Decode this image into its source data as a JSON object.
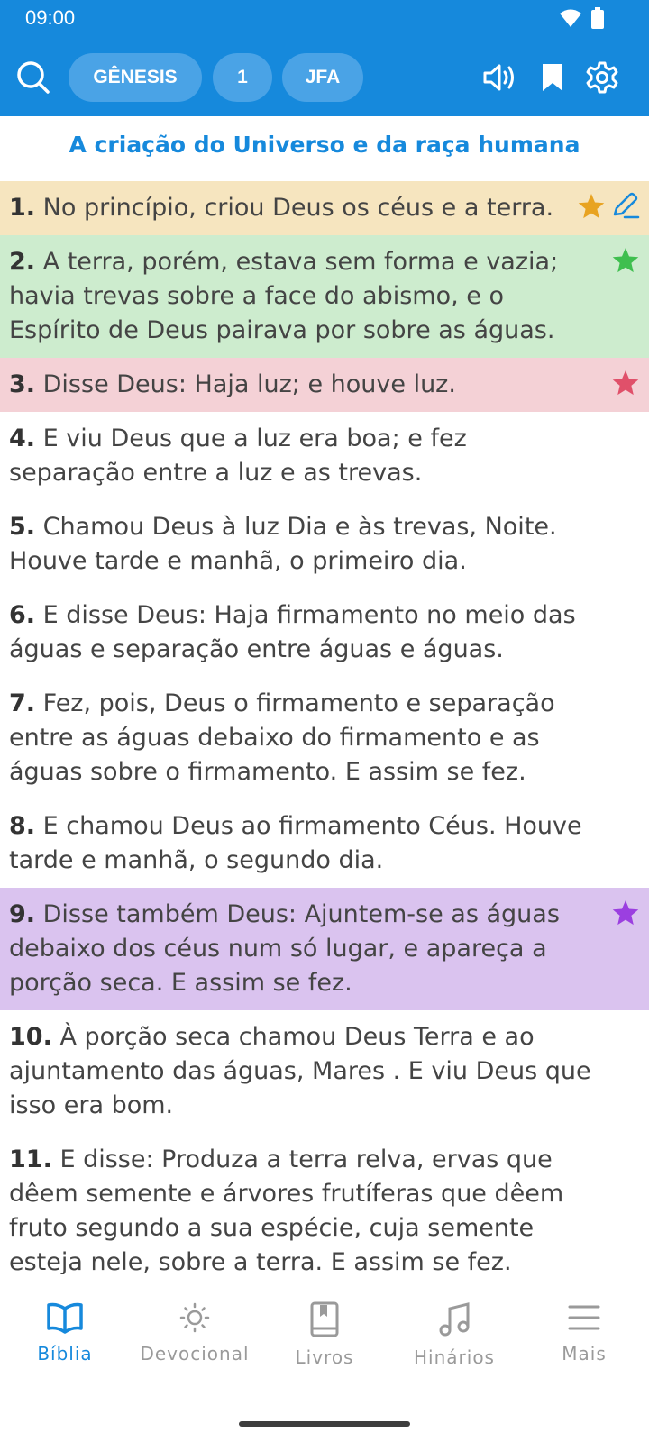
{
  "status": {
    "time": "09:00"
  },
  "toolbar": {
    "book": "GÊNESIS",
    "chapter": "1",
    "version": "JFA"
  },
  "chapter_title": "A criação do Universo e da raça humana",
  "verses": [
    {
      "num": "1.",
      "text": "No princípio, criou Deus os céus e a terra."
    },
    {
      "num": "2.",
      "text": "A terra, porém, estava sem forma e vazia; havia trevas sobre a face do abismo, e o Espírito de Deus pairava por sobre as águas."
    },
    {
      "num": "3.",
      "text": "Disse Deus: Haja luz; e houve luz."
    },
    {
      "num": "4.",
      "text": "E viu Deus que a luz era boa; e fez separação entre a luz e as trevas."
    },
    {
      "num": "5.",
      "text": "Chamou Deus à luz Dia e às trevas, Noite. Houve tarde e manhã, o primeiro dia."
    },
    {
      "num": "6.",
      "text": "E disse Deus: Haja firmamento no meio das águas e separação entre águas e águas."
    },
    {
      "num": "7.",
      "text": "Fez, pois, Deus o firmamento e separação entre as águas debaixo do firmamento e as águas sobre o firmamento. E assim se fez."
    },
    {
      "num": "8.",
      "text": "E chamou Deus ao firmamento Céus. Houve tarde e manhã, o segundo dia."
    },
    {
      "num": "9.",
      "text": "Disse também Deus: Ajuntem-se as águas debaixo dos céus num só lugar, e apareça a porção seca. E assim se fez."
    },
    {
      "num": "10.",
      "text": "À porção seca chamou Deus Terra e ao ajuntamento das águas, Mares . E viu Deus que isso era bom."
    },
    {
      "num": "11.",
      "text": "E disse: Produza a terra relva, ervas que dêem semente e árvores frutíferas que dêem fruto segundo a sua espécie, cuja semente esteja nele, sobre a terra. E assim se fez."
    }
  ],
  "highlights": {
    "yellow": "#f6e5bf",
    "green": "#cdecce",
    "red": "#f4d1d6",
    "purple": "#dac3ef"
  },
  "star_colors": {
    "yellow": "#e8a321",
    "green": "#3fbf4f",
    "red": "#e0506a",
    "purple": "#9b3fe0"
  },
  "nav": [
    {
      "label": "Bíblia",
      "icon": "open-book-icon",
      "active": true
    },
    {
      "label": "Devocional",
      "icon": "sun-icon",
      "active": false
    },
    {
      "label": "Livros",
      "icon": "book-icon",
      "active": false
    },
    {
      "label": "Hinários",
      "icon": "music-note-icon",
      "active": false
    },
    {
      "label": "Mais",
      "icon": "menu-icon",
      "active": false
    }
  ],
  "colors": {
    "primary": "#1689dc",
    "pill": "#4aa3e6",
    "inactive": "#9a9a9a"
  }
}
